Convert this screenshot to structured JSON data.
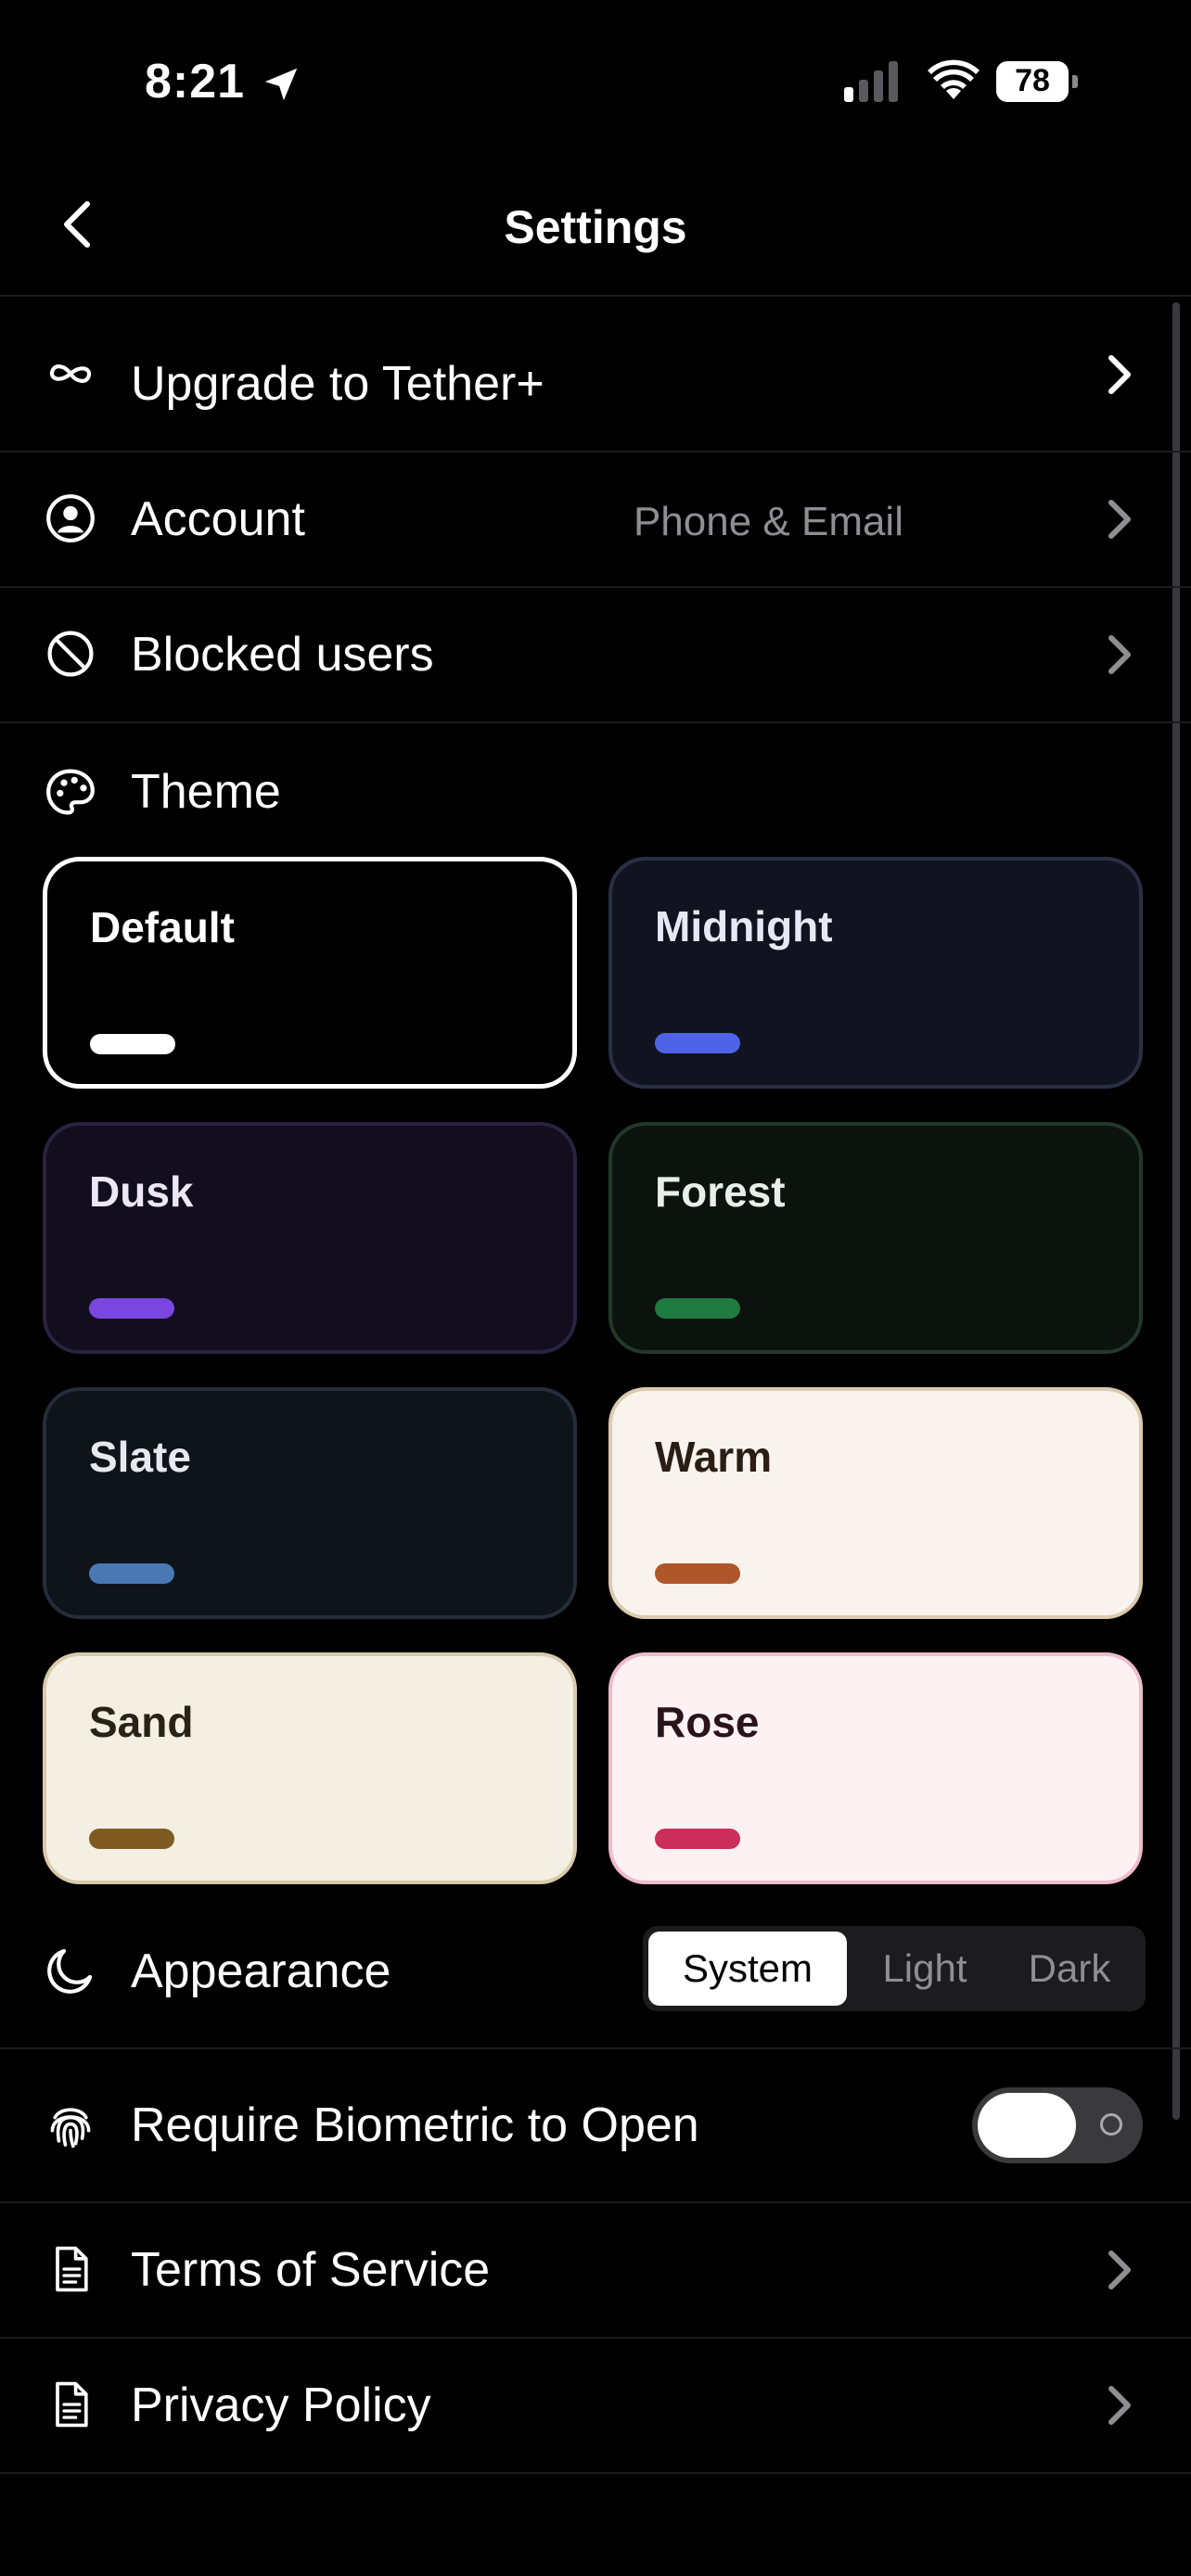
{
  "status_bar": {
    "time": "8:21",
    "battery": "78"
  },
  "nav": {
    "title": "Settings"
  },
  "rows": {
    "upgrade": {
      "label": "Upgrade to Tether+"
    },
    "account": {
      "label": "Account",
      "value": "Phone & Email"
    },
    "blocked": {
      "label": "Blocked users"
    },
    "theme": {
      "label": "Theme"
    },
    "appearance": {
      "label": "Appearance"
    },
    "biometric": {
      "label": "Require Biometric to Open",
      "enabled": false
    },
    "terms": {
      "label": "Terms of Service"
    },
    "privacy": {
      "label": "Privacy Policy"
    }
  },
  "themes": [
    {
      "name": "Default",
      "selected": true,
      "bg": "#000000",
      "border": "#ffffff",
      "text": "#ffffff",
      "accent": "#ffffff"
    },
    {
      "name": "Midnight",
      "selected": false,
      "bg": "#111420",
      "border": "#2a2f45",
      "text": "#e6e8f5",
      "accent": "#4f63e8"
    },
    {
      "name": "Dusk",
      "selected": false,
      "bg": "#120e1e",
      "border": "#2a2240",
      "text": "#ece6f7",
      "accent": "#7b46e0"
    },
    {
      "name": "Forest",
      "selected": false,
      "bg": "#0c130f",
      "border": "#22382a",
      "text": "#e6efe8",
      "accent": "#1f7a3f"
    },
    {
      "name": "Slate",
      "selected": false,
      "bg": "#0f131a",
      "border": "#262d3a",
      "text": "#e6eaf0",
      "accent": "#4a78b4"
    },
    {
      "name": "Warm",
      "selected": false,
      "bg": "#f8f3ec",
      "border": "#dccab0",
      "text": "#2a1e14",
      "accent": "#b0562b"
    },
    {
      "name": "Sand",
      "selected": false,
      "bg": "#f4efe3",
      "border": "#d8cbaa",
      "text": "#2a2216",
      "accent": "#7f5b21"
    },
    {
      "name": "Rose",
      "selected": false,
      "bg": "#fdf1f3",
      "border": "#eebcca",
      "text": "#2a1418",
      "accent": "#cc2e5b"
    }
  ],
  "appearance_options": [
    "System",
    "Light",
    "Dark"
  ],
  "appearance_selected": "System"
}
